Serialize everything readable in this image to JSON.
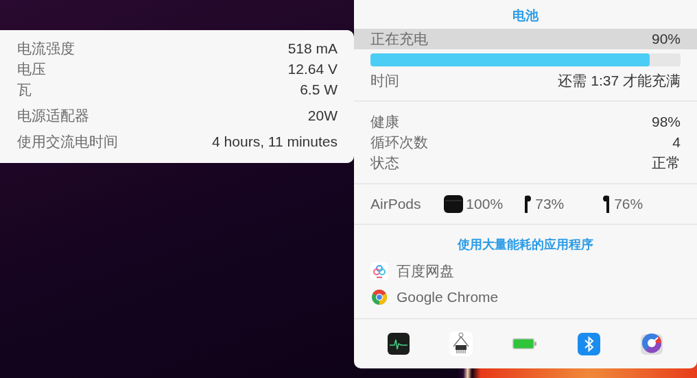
{
  "power_details": {
    "groups": [
      {
        "rows": [
          {
            "label": "电流强度",
            "value": "518 mA"
          },
          {
            "label": "电压",
            "value": "12.64 V"
          },
          {
            "label": "瓦",
            "value": "6.5 W"
          }
        ]
      },
      {
        "rows": [
          {
            "label": "电源适配器",
            "value": "20W"
          }
        ]
      },
      {
        "rows": [
          {
            "label": "使用交流电时间",
            "value": "4 hours, 11 minutes"
          }
        ]
      }
    ]
  },
  "battery_menu": {
    "title": "电池",
    "charge": {
      "label": "正在充电",
      "value": "90%",
      "highlighted": true,
      "level": 0.9
    },
    "time": {
      "label": "时间",
      "value": "还需 1:37 才能充满"
    },
    "health_rows": [
      {
        "label": "健康",
        "value": "98%"
      },
      {
        "label": "循环次数",
        "value": "4"
      },
      {
        "label": "状态",
        "value": "正常"
      }
    ],
    "airpods": {
      "label": "AirPods",
      "devices": [
        {
          "kind": "case",
          "reading": "100%"
        },
        {
          "kind": "left",
          "reading": "73%"
        },
        {
          "kind": "right",
          "reading": "76%"
        }
      ]
    },
    "apps_title": "使用大量能耗的应用程序",
    "apps": [
      {
        "kind": "baidu",
        "name": "百度网盘"
      },
      {
        "kind": "chrome",
        "name": "Google Chrome"
      }
    ],
    "toolbar": [
      {
        "kind": "activity"
      },
      {
        "kind": "chip"
      },
      {
        "kind": "battery"
      },
      {
        "kind": "bluetooth"
      },
      {
        "kind": "gauge"
      }
    ]
  }
}
